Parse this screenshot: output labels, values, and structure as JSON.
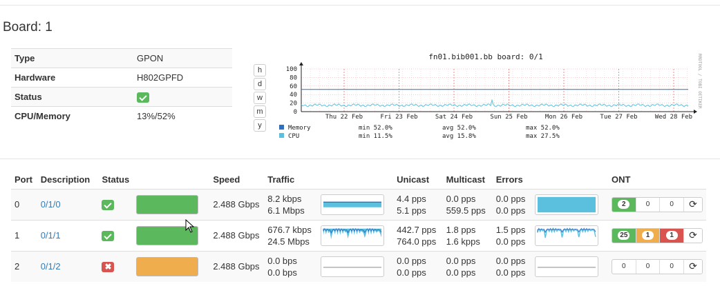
{
  "board": {
    "title": "Board: 1"
  },
  "info": {
    "type_label": "Type",
    "type_value": "GPON",
    "hardware_label": "Hardware",
    "hardware_value": "H802GPFD",
    "status_label": "Status",
    "status_value": "ok",
    "cpu_label": "CPU/Memory",
    "cpu_value": "13%/52%"
  },
  "period_buttons": [
    "h",
    "d",
    "w",
    "m",
    "y"
  ],
  "graph": {
    "title": "fn01.bib001.bb board: 0/1",
    "watermark": "RRDTOOL / TOBI OETIKER",
    "y_ticks": [
      "100",
      "80",
      "60",
      "40",
      "20",
      "0"
    ],
    "x_ticks": [
      "Thu 22 Feb",
      "Fri 23 Feb",
      "Sat 24 Feb",
      "Sun 25 Feb",
      "Mon 26 Feb",
      "Tue 27 Feb",
      "Wed 28 Feb"
    ],
    "colors": {
      "memory": "#2f6fbf",
      "cpu": "#5bc0de"
    },
    "legend": [
      {
        "name": "Memory",
        "min": "min 52.0%",
        "avg": "avg 52.0%",
        "max": "max 52.0%"
      },
      {
        "name": "CPU",
        "min": "min 11.5%",
        "avg": "avg 15.8%",
        "max": "max 27.5%"
      }
    ]
  },
  "ports": {
    "headers": [
      "Port",
      "Description",
      "Status",
      "Speed",
      "Traffic",
      "Unicast",
      "Multicast",
      "Errors",
      "ONT"
    ],
    "rows": [
      {
        "port": "0",
        "description": "0/1/0",
        "status": "ok",
        "status_icon": "check-icon",
        "bar_color": "#5cb85c",
        "speed": "2.488 Gbps",
        "traffic_in": "8.2 kbps",
        "traffic_out": "6.1 Mbps",
        "unicast_in": "4.4 pps",
        "unicast_out": "5.1 pps",
        "multicast_in": "0.0 pps",
        "multicast_out": "559.5 pps",
        "errors_in": "0.0 pps",
        "errors_out": "0.0 pps",
        "ont": [
          "2",
          "0",
          "0"
        ]
      },
      {
        "port": "1",
        "description": "0/1/1",
        "status": "ok",
        "status_icon": "check-icon",
        "bar_color": "#5cb85c",
        "speed": "2.488 Gbps",
        "traffic_in": "676.7 kbps",
        "traffic_out": "24.5 Mbps",
        "unicast_in": "442.7 pps",
        "unicast_out": "764.0 pps",
        "multicast_in": "1.8 pps",
        "multicast_out": "1.6 kpps",
        "errors_in": "1.5 pps",
        "errors_out": "0.0 pps",
        "ont": [
          "25",
          "1",
          "1"
        ]
      },
      {
        "port": "2",
        "description": "0/1/2",
        "status": "error",
        "status_icon": "cross-icon",
        "bar_color": "#f0ad4e",
        "speed": "2.488 Gbps",
        "traffic_in": "0.0 bps",
        "traffic_out": "0.0 bps",
        "unicast_in": "0.0 pps",
        "unicast_out": "0.0 pps",
        "multicast_in": "0.0 pps",
        "multicast_out": "0.0 pps",
        "errors_in": "0.0 pps",
        "errors_out": "0.0 pps",
        "ont": [
          "0",
          "0",
          "0"
        ]
      }
    ]
  }
}
